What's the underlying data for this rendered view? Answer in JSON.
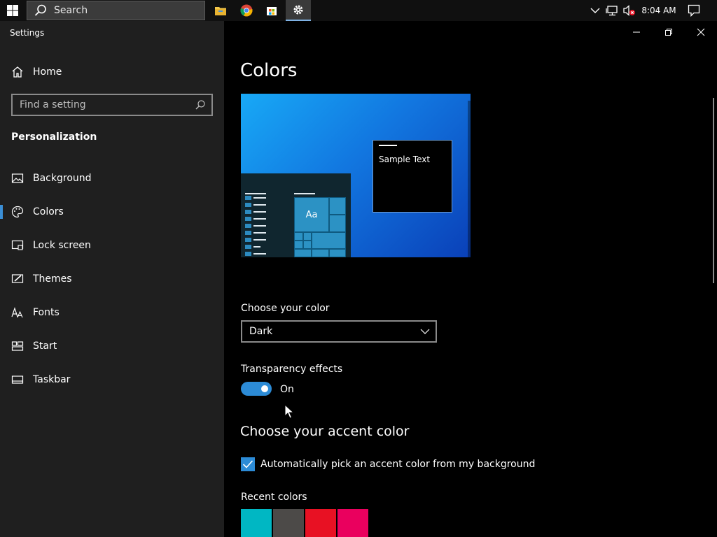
{
  "taskbar": {
    "search_label": "Search",
    "clock": "8:04 AM",
    "icons": [
      "windows-start-icon",
      "search-icon",
      "file-explorer-icon",
      "chrome-icon",
      "store-icon",
      "settings-gear-icon",
      "chevron-up-icon",
      "network-icon",
      "volume-muted-icon",
      "notifications-icon"
    ]
  },
  "window": {
    "title": "Settings",
    "controls": [
      "minimize-icon",
      "restore-icon",
      "close-icon"
    ]
  },
  "sidebar": {
    "home_label": "Home",
    "search_placeholder": "Find a setting",
    "section_title": "Personalization",
    "items": [
      {
        "label": "Background",
        "icon": "picture-icon",
        "selected": false
      },
      {
        "label": "Colors",
        "icon": "palette-icon",
        "selected": true
      },
      {
        "label": "Lock screen",
        "icon": "lock-screen-icon",
        "selected": false
      },
      {
        "label": "Themes",
        "icon": "themes-icon",
        "selected": false
      },
      {
        "label": "Fonts",
        "icon": "fonts-icon",
        "selected": false
      },
      {
        "label": "Start",
        "icon": "start-icon",
        "selected": false
      },
      {
        "label": "Taskbar",
        "icon": "taskbar-icon",
        "selected": false
      }
    ]
  },
  "main": {
    "page_title": "Colors",
    "preview": {
      "sample_text": "Sample Text",
      "tile_text": "Aa"
    },
    "choose_color_label": "Choose your color",
    "choose_color_value": "Dark",
    "transparency_label": "Transparency effects",
    "transparency_state": "On",
    "accent_heading": "Choose your accent color",
    "auto_accent_label": "Automatically pick an accent color from my background",
    "auto_accent_checked": true,
    "recent_colors_label": "Recent colors",
    "recent_colors": [
      "#00b7c3",
      "#4c4a48",
      "#e81123",
      "#ea005e"
    ]
  },
  "colors": {
    "accent": "#2c8bd6",
    "sidebar_bg": "#1f1f1f",
    "main_bg": "#000000"
  }
}
